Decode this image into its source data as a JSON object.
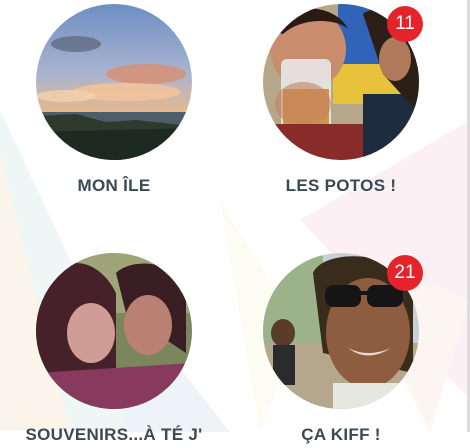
{
  "albums": [
    {
      "title": "MON ÎLE",
      "badge": "",
      "image": "sunset-coast-photo"
    },
    {
      "title": "LES POTOS !",
      "badge": "11",
      "image": "friend-with-drink-photo"
    },
    {
      "title": "SOUVENIRS...À TÉ J'",
      "badge": "",
      "image": "couple-selfie-photo"
    },
    {
      "title": "ÇA KIFF !",
      "badge": "21",
      "image": "sunglasses-selfie-photo"
    }
  ],
  "colors": {
    "badge": "#e5232b",
    "label": "#3a4a55"
  }
}
